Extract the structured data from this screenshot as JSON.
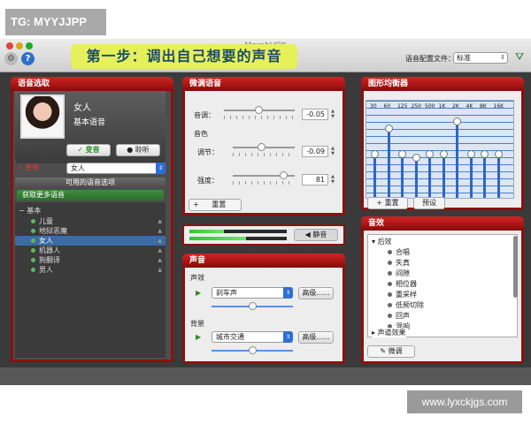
{
  "watermarks": {
    "top": "TG: MYYJJPP",
    "bottom": "www.lyxckjgs.com"
  },
  "app": {
    "title": "MorphVOX",
    "step_banner": "第一步：调出自己想要的声音"
  },
  "toolbar": {
    "preset_label": "语音配置文件：",
    "preset_value": "标准"
  },
  "voice_select": {
    "header": "语音选取",
    "current_name": "女人",
    "current_sub": "基本语音",
    "morph_button": "变音",
    "listen_button": "聆听",
    "update_button": "更新",
    "voice_dropdown": "女人",
    "available_header": "可用的语音选项",
    "get_more": "获取更多语音",
    "group": "基本",
    "items": [
      "儿童",
      "地狱恶魔",
      "女人",
      "机器人",
      "狗翻译",
      "男人"
    ],
    "selected_index": 2
  },
  "tweak": {
    "header": "微调语音",
    "pitch_label": "音调：",
    "pitch_value": "-0.05",
    "pitch_level": 0.49,
    "timbre_label": "音色",
    "adjust_label": "调节：",
    "adjust_value": "-0.09",
    "adjust_level": 0.46,
    "strength_label": "强度：",
    "strength_value": "81",
    "strength_level": 0.81,
    "reset_button": "重置"
  },
  "meter": {
    "mute_button": "静音",
    "level_top": 0.35,
    "level_bottom": 0.58
  },
  "sound": {
    "header": "声音",
    "effect_label": "声效",
    "effect_value": "刹车声",
    "effect_adv": "高级......",
    "effect_level": 0.5,
    "bg_label": "背景",
    "bg_value": "城市交通",
    "bg_adv": "高级......",
    "bg_level": 0.5
  },
  "eq": {
    "header": "图形均衡器",
    "bands": [
      "30",
      "60",
      "125",
      "250",
      "500",
      "1K",
      "2K",
      "4K",
      "8K",
      "16K"
    ],
    "levels": [
      0.5,
      0.82,
      0.5,
      0.46,
      0.5,
      0.5,
      0.9,
      0.5,
      0.5,
      0.5
    ],
    "reset_button": "重置",
    "preset_button": "预设"
  },
  "effects": {
    "header": "音效",
    "group_after": "后效",
    "items": [
      "合唱",
      "失真",
      "间隙",
      "相位器",
      "重采样",
      "低频切除",
      "回声",
      "混响"
    ],
    "group_voice": "声道效果",
    "tweak_button": "微调"
  }
}
